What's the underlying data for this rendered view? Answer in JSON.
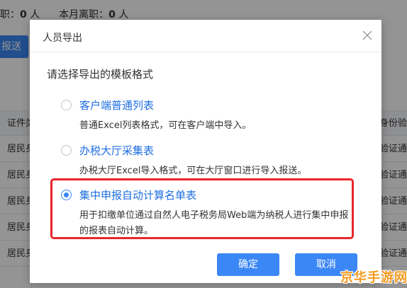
{
  "background": {
    "stats_text": "职：0 人　本月离职：0 人",
    "stats": [
      {
        "label": "职：",
        "value": "0",
        "unit": "人"
      },
      {
        "label": "本月离职：",
        "value": "0",
        "unit": "人"
      }
    ],
    "action_button": "报送",
    "table": {
      "header_left": "证件类",
      "header_right": "身份验",
      "rows": [
        {
          "left": "居民身",
          "right": "验证通"
        },
        {
          "left": "居民身",
          "right": "验证通"
        },
        {
          "left": "居民身",
          "right": "验证通"
        },
        {
          "left": "居民身",
          "right": "验证通"
        },
        {
          "left": "居民身",
          "right": "验证通"
        }
      ]
    }
  },
  "dialog": {
    "title": "人员导出",
    "prompt": "请选择导出的模板格式",
    "options": [
      {
        "title": "客户端普通列表",
        "description": "普通Excel列表格式，可在客户端中导入。",
        "selected": false
      },
      {
        "title": "办税大厅采集表",
        "description": "办税大厅Excel导入格式，可在大厅窗口进行导入报送。",
        "selected": false
      },
      {
        "title": "集中申报自动计算名单表",
        "description": "用于扣缴单位通过自然人电子税务局Web端为纳税人进行集中申报的报表自动计算。",
        "selected": true
      }
    ],
    "confirm_label": "确定",
    "cancel_label": "取消"
  },
  "watermark": "京华手游网",
  "colors": {
    "primary": "#3b87f5",
    "option_title": "#1f6fe0",
    "highlight_border": "#e8262a",
    "watermark": "#f39a1e"
  }
}
